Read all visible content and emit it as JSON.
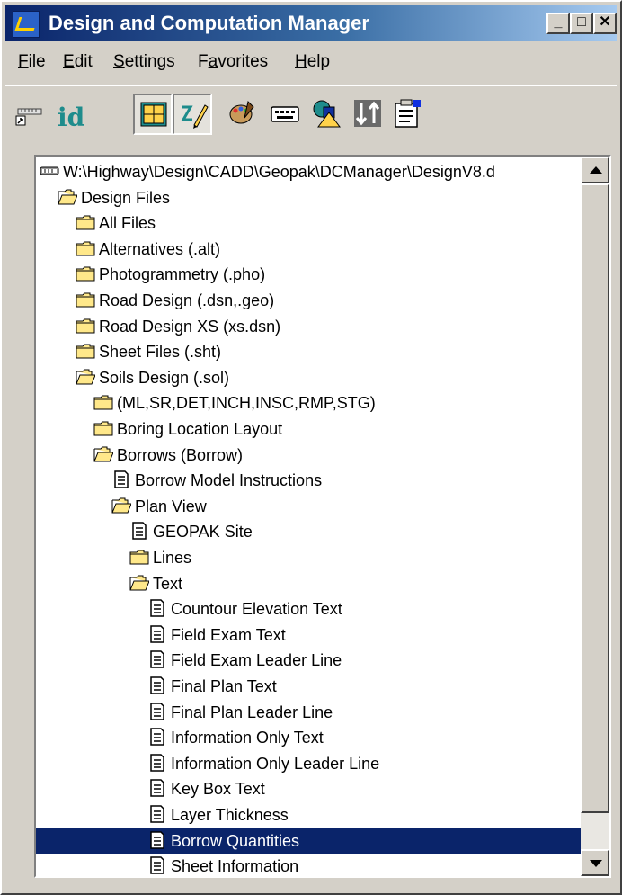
{
  "window": {
    "title": "Design and Computation Manager"
  },
  "caption_buttons": {
    "minimize": "_",
    "maximize": "□",
    "close": "✕"
  },
  "menu": [
    {
      "label": "File"
    },
    {
      "label": "Edit"
    },
    {
      "label": "Settings"
    },
    {
      "label": "Favorites"
    },
    {
      "label": "Help"
    }
  ],
  "toolbar": {
    "id_label": "id",
    "buttons": [
      {
        "name": "ruler-icon"
      },
      {
        "name": "id-icon"
      },
      {
        "name": "grid-window-icon",
        "pressed": true
      },
      {
        "name": "draw-pencil-icon",
        "pressed": true
      },
      {
        "name": "palette-icon"
      },
      {
        "name": "keyboard-icon"
      },
      {
        "name": "shapes-icon"
      },
      {
        "name": "sort-icon"
      },
      {
        "name": "properties-icon"
      }
    ]
  },
  "tree": {
    "rows": [
      {
        "label": "W:\\Highway\\Design\\CADD\\Geopak\\DCManager\\DesignV8.d",
        "icon": "database-icon",
        "level": 0
      },
      {
        "label": "Design Files",
        "icon": "folder-open-icon",
        "level": 1
      },
      {
        "label": "All Files",
        "icon": "folder-icon",
        "level": 2
      },
      {
        "label": "Alternatives (.alt)",
        "icon": "folder-icon",
        "level": 2
      },
      {
        "label": "Photogrammetry (.pho)",
        "icon": "folder-icon",
        "level": 2
      },
      {
        "label": "Road Design (.dsn,.geo)",
        "icon": "folder-icon",
        "level": 2
      },
      {
        "label": "Road Design XS (xs.dsn)",
        "icon": "folder-icon",
        "level": 2
      },
      {
        "label": "Sheet Files (.sht)",
        "icon": "folder-icon",
        "level": 2
      },
      {
        "label": "Soils Design (.sol)",
        "icon": "folder-open-icon",
        "level": 2
      },
      {
        "label": "(ML,SR,DET,INCH,INSC,RMP,STG)",
        "icon": "folder-icon",
        "level": 3
      },
      {
        "label": "Boring Location Layout",
        "icon": "folder-icon",
        "level": 3
      },
      {
        "label": "Borrows (Borrow)",
        "icon": "folder-open-icon",
        "level": 3
      },
      {
        "label": "Borrow Model Instructions",
        "icon": "document-icon",
        "level": 4
      },
      {
        "label": "Plan View",
        "icon": "folder-open-icon",
        "level": 4
      },
      {
        "label": "GEOPAK Site",
        "icon": "document-icon",
        "level": 5
      },
      {
        "label": "Lines",
        "icon": "folder-icon",
        "level": 5
      },
      {
        "label": "Text",
        "icon": "folder-open-icon",
        "level": 5
      },
      {
        "label": "Countour Elevation Text",
        "icon": "document-icon",
        "level": 6
      },
      {
        "label": "Field Exam Text",
        "icon": "document-icon",
        "level": 6
      },
      {
        "label": "Field Exam Leader Line",
        "icon": "document-icon",
        "level": 6
      },
      {
        "label": "Final Plan Text",
        "icon": "document-icon",
        "level": 6
      },
      {
        "label": "Final Plan Leader Line",
        "icon": "document-icon",
        "level": 6
      },
      {
        "label": "Information Only Text",
        "icon": "document-icon",
        "level": 6
      },
      {
        "label": "Information Only Leader Line",
        "icon": "document-icon",
        "level": 6
      },
      {
        "label": "Key Box Text",
        "icon": "document-icon",
        "level": 6
      },
      {
        "label": "Layer Thickness",
        "icon": "document-icon",
        "level": 6
      },
      {
        "label": "Borrow  Quantities",
        "icon": "document-icon",
        "level": 6,
        "selected": true
      },
      {
        "label": "Sheet Information",
        "icon": "document-icon",
        "level": 6
      }
    ]
  },
  "colors": {
    "selection": "#0a246a",
    "titlebar_start": "#0a246a",
    "titlebar_end": "#a6caf0",
    "folder": "#ffe88a"
  }
}
